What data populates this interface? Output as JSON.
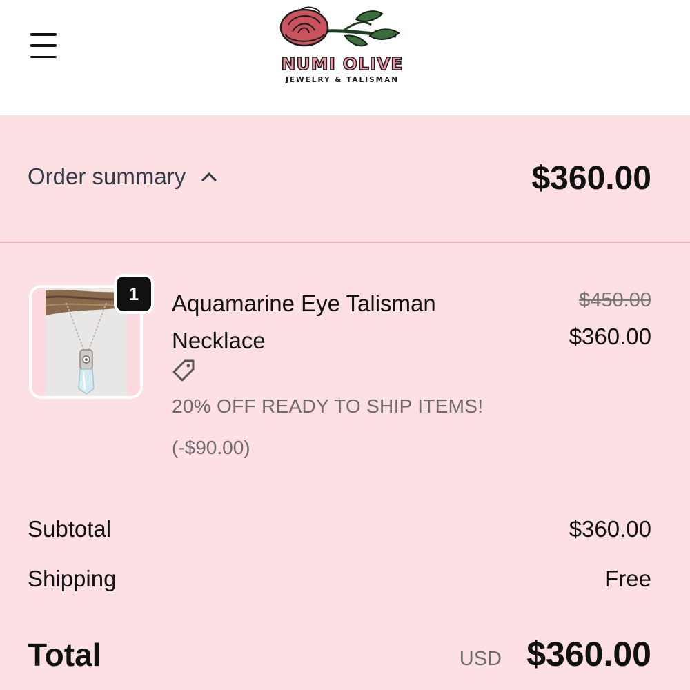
{
  "header": {
    "logo_text": "NUMI OLIVE",
    "logo_subtitle": "JEWELRY & TALISMAN",
    "menu_icon": "hamburger-menu-icon"
  },
  "summary": {
    "toggle_label": "Order summary",
    "toggle_icon": "chevron-up-icon",
    "total": "$360.00"
  },
  "item": {
    "quantity": "1",
    "name": "Aquamarine Eye Talisman Necklace",
    "original_price": "$450.00",
    "price": "$360.00",
    "discount_icon": "tag-icon",
    "discount_label": "20% OFF READY TO SHIP ITEMS!",
    "discount_amount": "(-$90.00)"
  },
  "totals": {
    "subtotal_label": "Subtotal",
    "subtotal_value": "$360.00",
    "shipping_label": "Shipping",
    "shipping_value": "Free",
    "total_label": "Total",
    "currency": "USD",
    "total_value": "$360.00"
  },
  "colors": {
    "panel_background": "#fde0e3",
    "logo_pink": "#f19aa7",
    "muted_text": "#6f6a6c"
  }
}
